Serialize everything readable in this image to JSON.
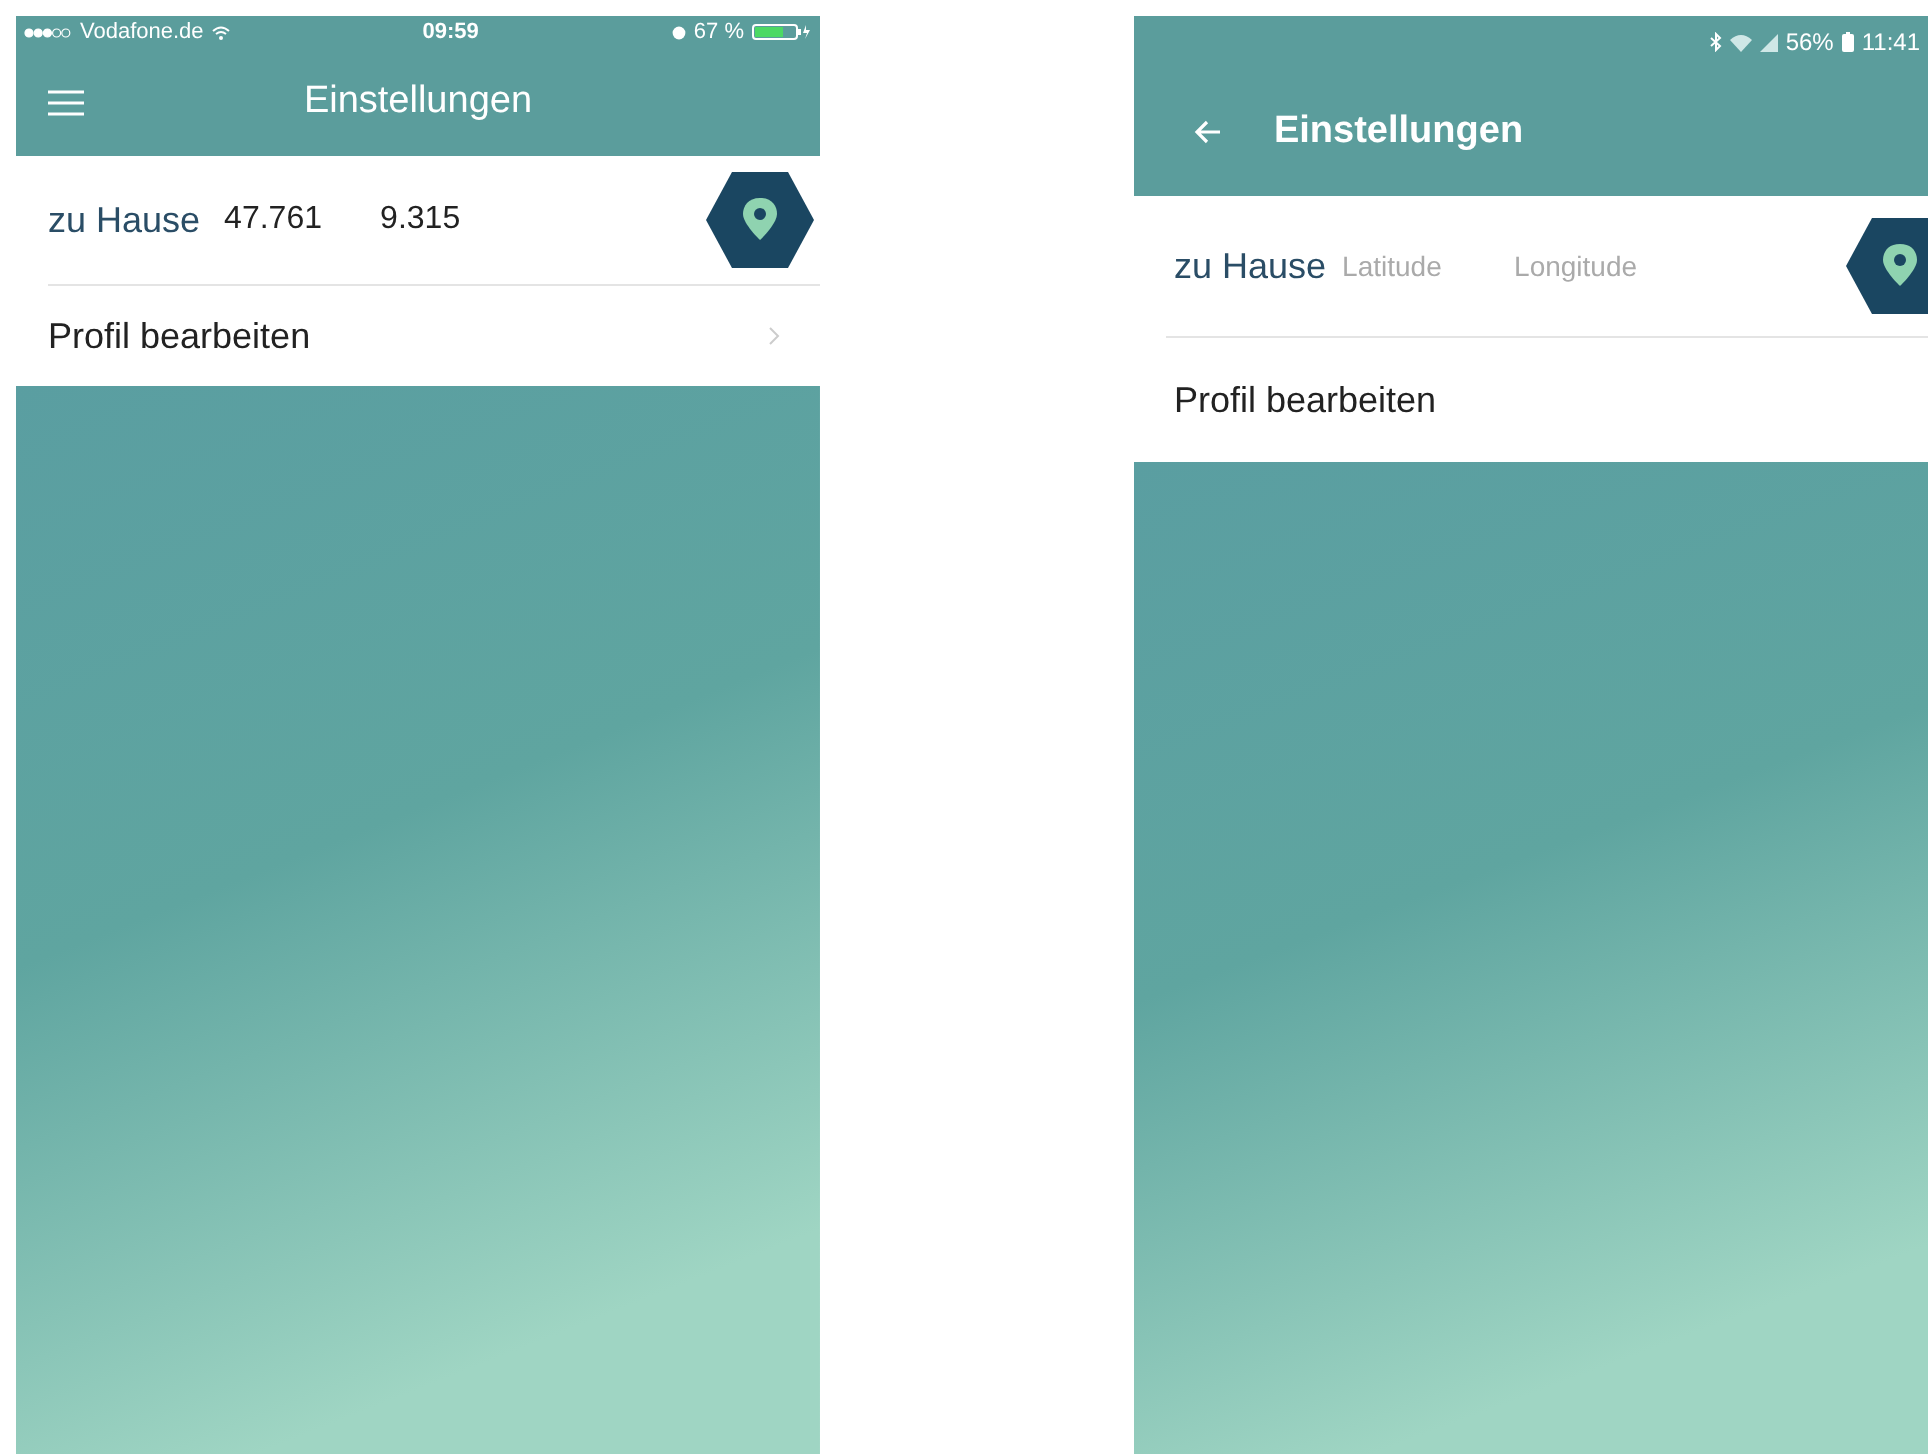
{
  "phones": [
    {
      "kind": "ios",
      "status": {
        "carrier": "Vodafone.de",
        "time": "09:59",
        "battery": "67 %"
      },
      "header": {
        "kind": "menu",
        "title": "Einstellungen"
      },
      "location": {
        "name": "zu Hause",
        "latitude": {
          "value": "47.761"
        },
        "longitude": {
          "value": "9.315"
        }
      },
      "profile": {
        "label": "Profil bearbeiten",
        "chevron": true
      }
    },
    {
      "kind": "android",
      "status": {
        "battery": "56%",
        "time": "11:41"
      },
      "header": {
        "kind": "back",
        "title": "Einstellungen"
      },
      "location": {
        "name": "zu Hause",
        "latitude": {
          "placeholder": "Latitude"
        },
        "longitude": {
          "placeholder": "Longitude"
        }
      },
      "profile": {
        "label": "Profil bearbeiten",
        "chevron": false
      }
    }
  ]
}
